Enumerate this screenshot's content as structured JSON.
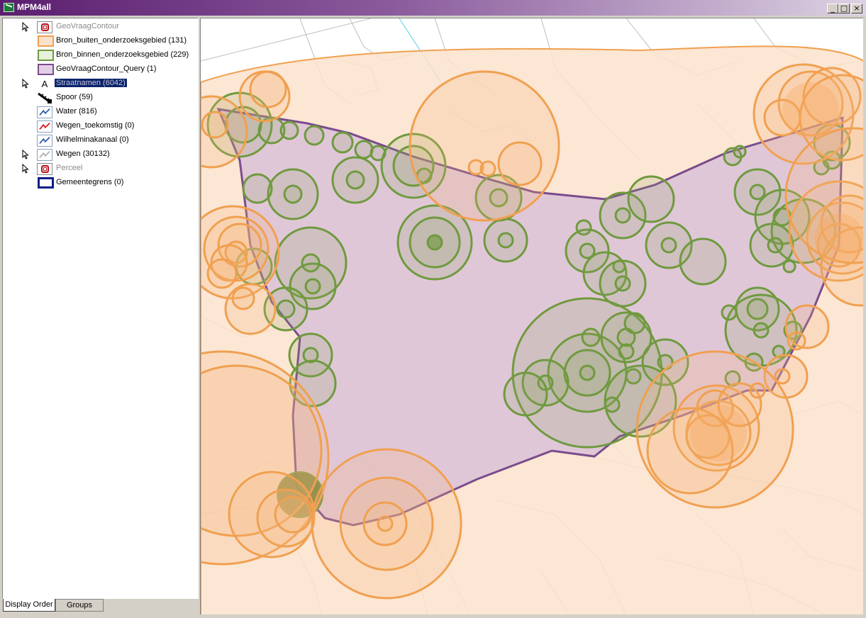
{
  "window": {
    "title": "MPM4all"
  },
  "legend": {
    "layers": [
      {
        "label": "GeoVraagContour",
        "symbol": "group-icon",
        "selectable": true,
        "dimmed": true
      },
      {
        "label": "Bron_buiten_onderzoeksgebied (131)",
        "symbol": "orange-polygon-icon"
      },
      {
        "label": "Bron_binnen_onderzoeksgebied (229)",
        "symbol": "green-polygon-icon"
      },
      {
        "label": "GeoVraagContour_Query (1)",
        "symbol": "purple-polygon-icon"
      },
      {
        "label": "Straatnamen (6042)",
        "symbol": "text-label-icon",
        "glyph": "A",
        "selectable": true,
        "selected": true
      },
      {
        "label": "Spoor (59)",
        "symbol": "rail-line-icon"
      },
      {
        "label": "Water (816)",
        "symbol": "water-line-icon"
      },
      {
        "label": "Wegen_toekomstig (0)",
        "symbol": "future-roads-line-icon"
      },
      {
        "label": "Wilhelminakanaal (0)",
        "symbol": "canal-line-icon"
      },
      {
        "label": "Wegen (30132)",
        "symbol": "roads-line-icon",
        "selectable": true
      },
      {
        "label": "Perceel",
        "symbol": "group-icon",
        "selectable": true,
        "dimmed": true
      },
      {
        "label": "Gemeentegrens (0)",
        "symbol": "navy-polygon-icon"
      }
    ]
  },
  "tabs": {
    "display_order": "Display Order",
    "groups": "Groups"
  },
  "colors": {
    "orange": "#f0a050",
    "green": "#6f9a3e",
    "purple": "#7a4c8c",
    "navy": "#0d1f86",
    "selection": "#0a246a"
  }
}
